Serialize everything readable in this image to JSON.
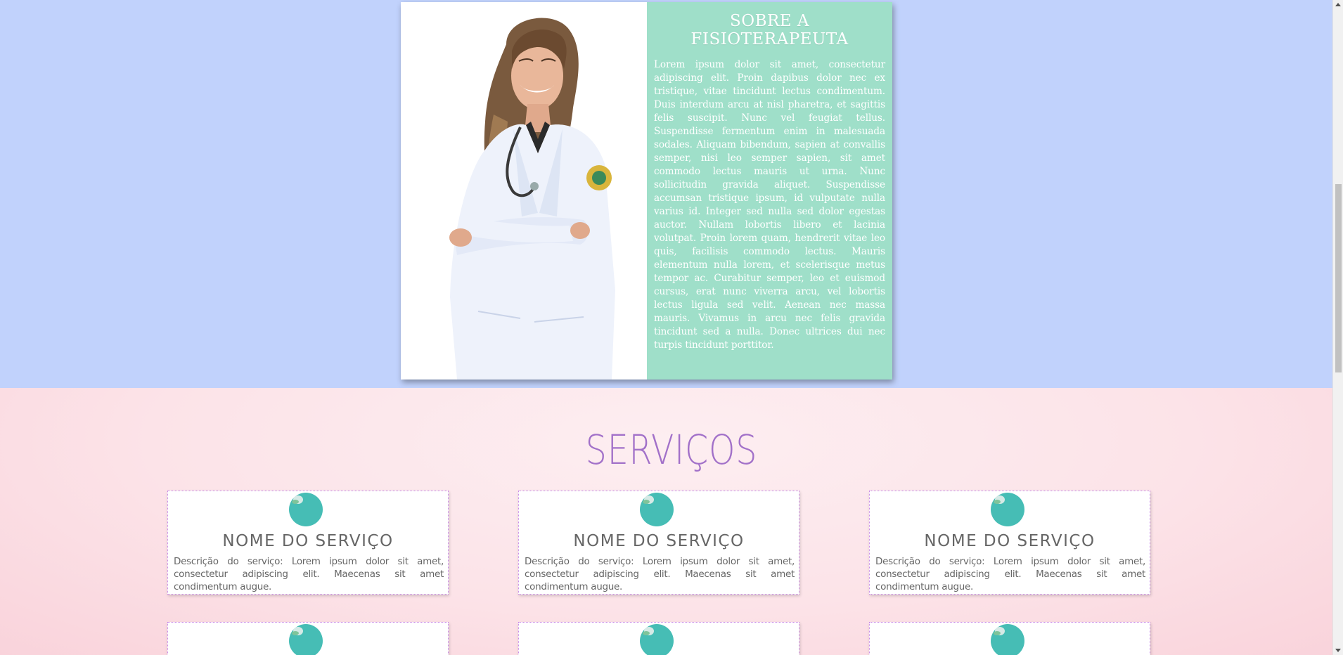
{
  "about": {
    "title": "SOBRE A FISIOTERAPEUTA",
    "body": "Lorem ipsum dolor sit amet, consectetur adipiscing elit. Proin dapibus dolor nec ex tristique, vitae tincidunt lectus condimentum. Duis interdum arcu at nisl pharetra, et sagittis felis suscipit. Nunc vel feugiat tellus. Suspendisse fermentum enim in malesuada sodales. Aliquam bibendum, sapien at convallis semper, nisi leo semper sapien, sit amet commodo lectus mauris ut urna. Nunc sollicitudin gravida aliquet. Suspendisse accumsan tristique ipsum, id vulputate nulla varius id. Integer sed nulla sed dolor egestas auctor. Nullam lobortis libero et lacinia volutpat. Proin lorem quam, hendrerit vitae leo quis, facilisis commodo lectus. Mauris elementum nulla lorem, et scelerisque metus tempor ac. Curabitur semper, leo et euismod cursus, erat nunc viverra arcu, vel lobortis lectus ligula sed velit. Aenean nec massa mauris. Vivamus in arcu nec felis gravida tincidunt sed a nulla. Donec ultrices dui nec turpis tincidunt porttitor.",
    "photo_icon": "physiotherapist-photo"
  },
  "services": {
    "title": "SERVIÇOS",
    "items": [
      {
        "name": "NOME DO SERVIÇO",
        "description": "Descrição do serviço: Lorem ipsum dolor sit amet, consectetur adipiscing elit. Maecenas sit amet condimentum augue."
      },
      {
        "name": "NOME DO SERVIÇO",
        "description": "Descrição do serviço: Lorem ipsum dolor sit amet, consectetur adipiscing elit. Maecenas sit amet condimentum augue."
      },
      {
        "name": "NOME DO SERVIÇO",
        "description": "Descrição do serviço: Lorem ipsum dolor sit amet, consectetur adipiscing elit. Maecenas sit amet condimentum augue."
      }
    ],
    "icon": "service-logo-icon"
  },
  "colors": {
    "top_band": "#c1d2fc",
    "about_text_bg": "#9fdfc9",
    "services_title": "#a271c9",
    "service_icon": "#46bdb5",
    "services_bg": "#fde3e8"
  }
}
